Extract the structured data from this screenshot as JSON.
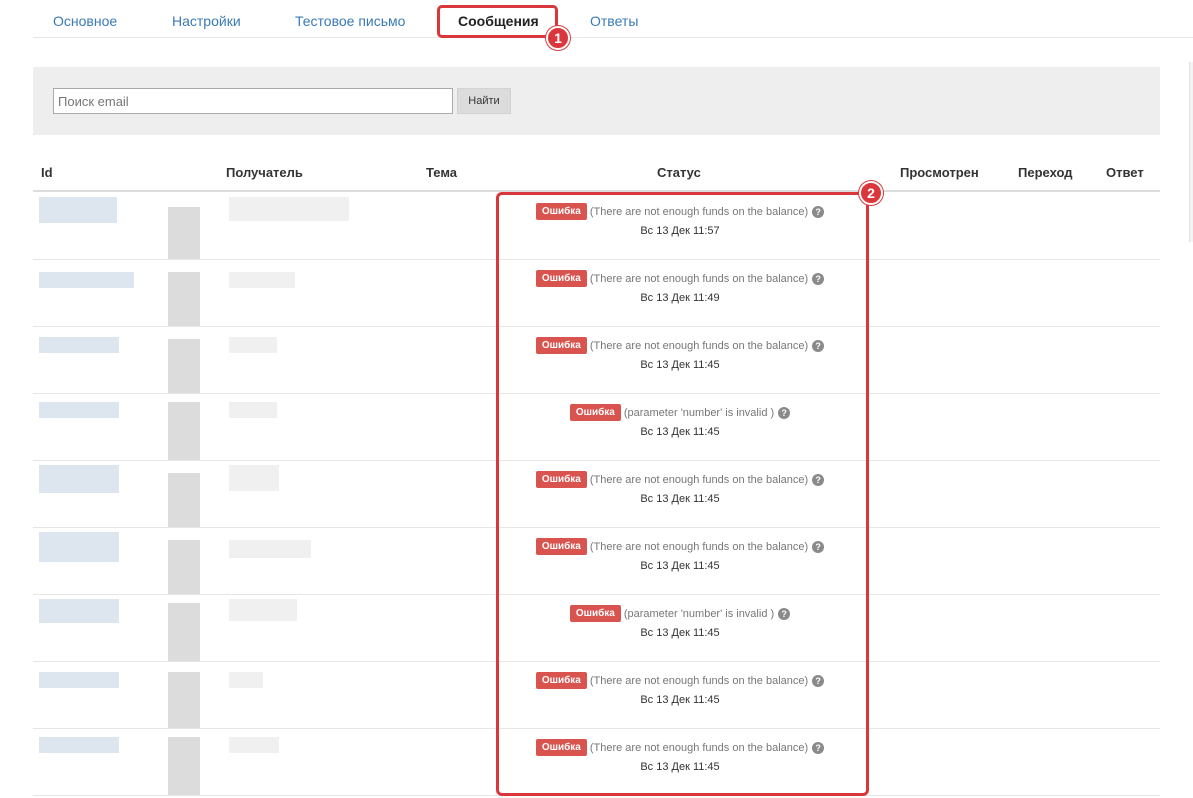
{
  "tabs": [
    {
      "label": "Основное",
      "active": false
    },
    {
      "label": "Настройки",
      "active": false
    },
    {
      "label": "Тестовое письмо",
      "active": false
    },
    {
      "label": "Сообщения",
      "active": true
    },
    {
      "label": "Ответы",
      "active": false
    }
  ],
  "search": {
    "placeholder": "Поиск email",
    "value": "",
    "button_label": "Найти"
  },
  "table": {
    "headers": {
      "id": "Id",
      "recipient": "Получатель",
      "subject": "Тема",
      "status": "Статус",
      "viewed": "Просмотрен",
      "click": "Переход",
      "reply": "Ответ"
    },
    "rows": [
      {
        "status_badge": "Ошибка",
        "status_text": "(There are not enough funds on the balance)",
        "date": "Вс 13 Дек 11:57"
      },
      {
        "status_badge": "Ошибка",
        "status_text": "(There are not enough funds on the balance)",
        "date": "Вс 13 Дек 11:49"
      },
      {
        "status_badge": "Ошибка",
        "status_text": "(There are not enough funds on the balance)",
        "date": "Вс 13 Дек 11:45"
      },
      {
        "status_badge": "Ошибка",
        "status_text": "(parameter 'number' is invalid )",
        "date": "Вс 13 Дек 11:45"
      },
      {
        "status_badge": "Ошибка",
        "status_text": "(There are not enough funds on the balance)",
        "date": "Вс 13 Дек 11:45"
      },
      {
        "status_badge": "Ошибка",
        "status_text": "(There are not enough funds on the balance)",
        "date": "Вс 13 Дек 11:45"
      },
      {
        "status_badge": "Ошибка",
        "status_text": "(parameter 'number' is invalid )",
        "date": "Вс 13 Дек 11:45"
      },
      {
        "status_badge": "Ошибка",
        "status_text": "(There are not enough funds on the balance)",
        "date": "Вс 13 Дек 11:45"
      },
      {
        "status_badge": "Ошибка",
        "status_text": "(There are not enough funds on the balance)",
        "date": "Вс 13 Дек 11:45"
      }
    ]
  },
  "annotations": {
    "marker_1": "1",
    "marker_2": "2"
  },
  "colors": {
    "accent_link": "#3a7ab8",
    "error_badge": "#d9534f",
    "annotation": "#d9373b"
  },
  "icons": {
    "help": "question-circle-icon"
  }
}
